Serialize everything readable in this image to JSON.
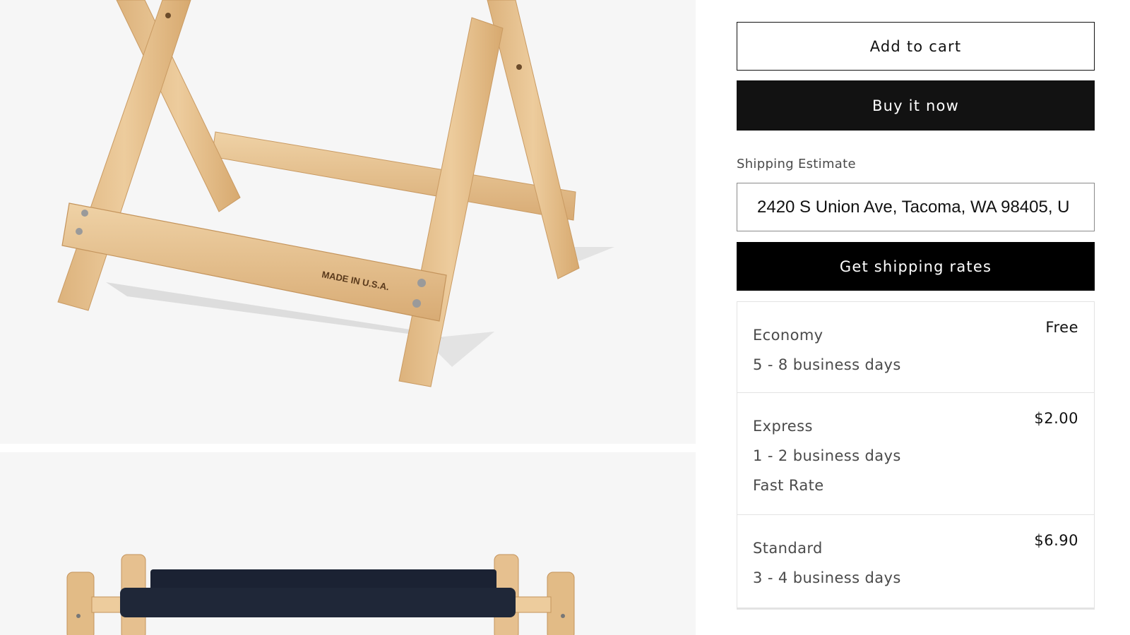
{
  "product_form": {
    "add_to_cart_label": "Add to cart",
    "buy_now_label": "Buy it now"
  },
  "shipping": {
    "label": "Shipping Estimate",
    "address_value": "2420 S Union Ave, Tacoma, WA 98405, U",
    "get_rates_label": "Get shipping rates",
    "rates": [
      {
        "name": "Economy",
        "price": "Free",
        "time": "5 - 8 business days",
        "note": ""
      },
      {
        "name": "Express",
        "price": "$2.00",
        "time": "1 - 2 business days",
        "note": "Fast Rate"
      },
      {
        "name": "Standard",
        "price": "$6.90",
        "time": "3 - 4 business days",
        "note": ""
      }
    ]
  },
  "gallery": {
    "stamp_text": "MADE IN U.S.A.",
    "colors": {
      "wood": "#e6c08f",
      "canvas": "#1b2233",
      "background": "#f6f6f6"
    }
  }
}
